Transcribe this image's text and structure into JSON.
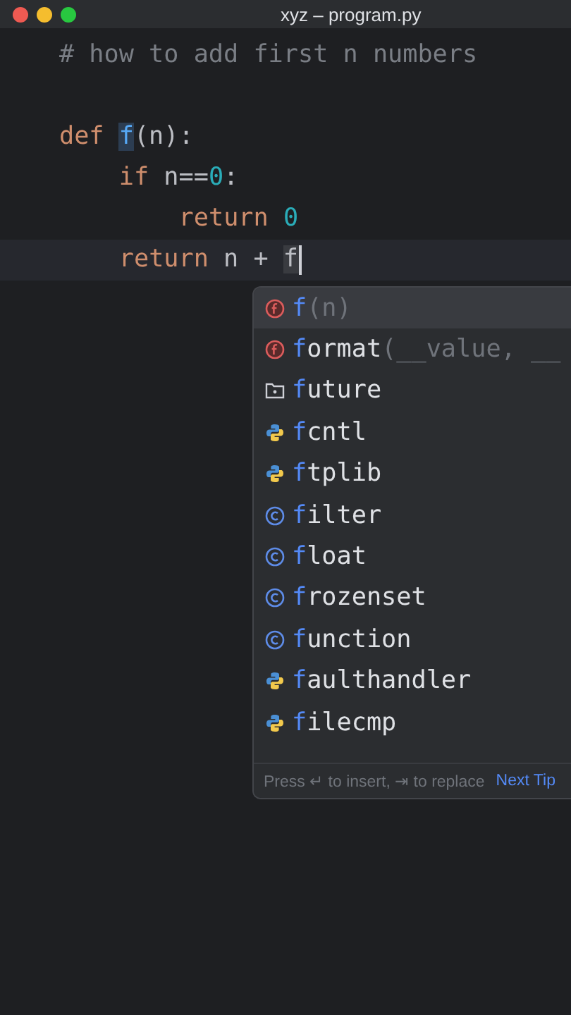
{
  "window": {
    "title": "xyz – program.py"
  },
  "editor": {
    "lines": [
      {
        "current": false,
        "tokens": [
          {
            "text": "# how to add first n numbers",
            "kind": "comment"
          }
        ]
      },
      {
        "current": false,
        "tokens": [
          {
            "text": "def ",
            "kind": "keyword"
          },
          {
            "text": "f",
            "kind": "definition"
          },
          {
            "text": "(n):",
            "kind": "plain"
          }
        ],
        "children": [
          {
            "current": false,
            "tokens": [
              {
                "text": "if ",
                "kind": "keyword"
              },
              {
                "text": "n==",
                "kind": "plain"
              },
              {
                "text": "0",
                "kind": "number"
              },
              {
                "text": ":",
                "kind": "plain"
              }
            ],
            "children": [
              {
                "current": false,
                "tokens": [
                  {
                    "text": "return ",
                    "kind": "keyword"
                  },
                  {
                    "text": "0",
                    "kind": "number"
                  }
                ]
              }
            ]
          },
          {
            "current": true,
            "tokens": [
              {
                "text": "return ",
                "kind": "keyword"
              },
              {
                "text": "n + ",
                "kind": "plain"
              },
              {
                "text": "f",
                "kind": "typed"
              }
            ]
          }
        ]
      }
    ]
  },
  "completion": {
    "items": [
      {
        "kind": "function",
        "match": "f",
        "params": "(n)",
        "selected": true
      },
      {
        "kind": "function",
        "match": "f",
        "name": "ormat",
        "params": "(__value, __",
        "selected": false
      },
      {
        "kind": "package",
        "match": "f",
        "name": "uture",
        "selected": false
      },
      {
        "kind": "module",
        "match": "f",
        "name": "cntl",
        "selected": false
      },
      {
        "kind": "module",
        "match": "f",
        "name": "tplib",
        "selected": false
      },
      {
        "kind": "class",
        "match": "f",
        "name": "ilter",
        "selected": false
      },
      {
        "kind": "class",
        "match": "f",
        "name": "loat",
        "selected": false
      },
      {
        "kind": "class",
        "match": "f",
        "name": "rozenset",
        "selected": false
      },
      {
        "kind": "class",
        "match": "f",
        "name": "unction",
        "selected": false
      },
      {
        "kind": "module",
        "match": "f",
        "name": "aulthandler",
        "selected": false
      },
      {
        "kind": "module",
        "match": "f",
        "name": "ilecmp",
        "selected": false
      }
    ],
    "hint": "Press ↵ to insert, ⇥ to replace",
    "link": "Next Tip"
  }
}
